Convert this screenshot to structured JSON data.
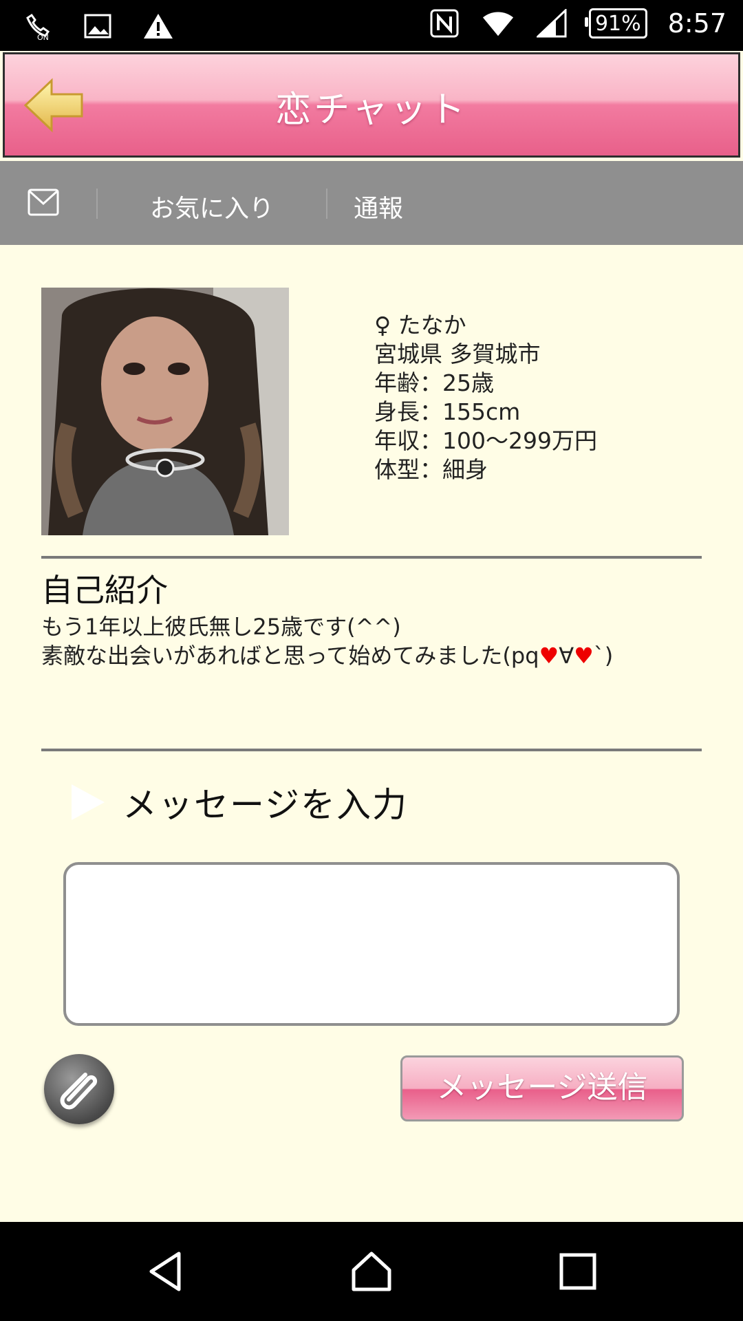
{
  "status_bar": {
    "left_icons": [
      "wifi-calling-icon",
      "image-icon",
      "warning-icon"
    ],
    "right_icons": [
      "nfc-icon",
      "wifi-icon",
      "signal-icon"
    ],
    "battery": "91%",
    "time": "8:57"
  },
  "header": {
    "title": "恋チャット",
    "back_icon": "back-arrow-icon"
  },
  "toolbar": {
    "mail_icon": "mail-icon",
    "favorite_label": "お気に入り",
    "report_label": "通報"
  },
  "profile": {
    "name": "♀ たなか",
    "location": "宮城県 多賀城市",
    "age": "年齢：25歳",
    "height": "身長：155cm",
    "income": "年収：100〜299万円",
    "body_type": "体型：細身"
  },
  "intro": {
    "title": "自己紹介",
    "line1": "もう1年以上彼氏無し25歳です(^^)",
    "line2_part1": "素敵な出会いがあればと思って始めてみました(pq",
    "heart": "♥",
    "line2_part2": "∀",
    "line2_part3": "`)"
  },
  "message": {
    "label": "メッセージを入力",
    "input_value": "",
    "send_label": "メッセージ送信"
  },
  "nav": {
    "icons": [
      "back-nav-icon",
      "home-nav-icon",
      "recents-nav-icon"
    ]
  },
  "colors": {
    "header_pink": "#e8608a",
    "toolbar_gray": "#8f8f8f",
    "page_background": "#fffde6"
  }
}
